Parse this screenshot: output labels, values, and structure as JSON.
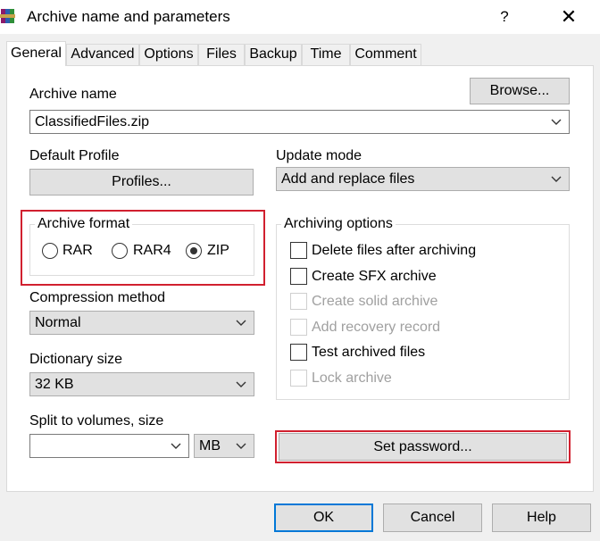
{
  "window": {
    "title": "Archive name and parameters",
    "help_glyph": "?",
    "close_glyph": "✕"
  },
  "tabs": [
    {
      "label": "General",
      "active": true
    },
    {
      "label": "Advanced"
    },
    {
      "label": "Options"
    },
    {
      "label": "Files"
    },
    {
      "label": "Backup"
    },
    {
      "label": "Time"
    },
    {
      "label": "Comment"
    }
  ],
  "archive_name": {
    "label": "Archive name",
    "value": "ClassifiedFiles.zip",
    "browse_label": "Browse..."
  },
  "profile": {
    "label": "Default Profile",
    "button": "Profiles..."
  },
  "update_mode": {
    "label": "Update mode",
    "value": "Add and replace files"
  },
  "archive_format": {
    "title": "Archive format",
    "options": [
      {
        "label": "RAR",
        "selected": false
      },
      {
        "label": "RAR4",
        "selected": false
      },
      {
        "label": "ZIP",
        "selected": true
      }
    ]
  },
  "compression": {
    "label": "Compression method",
    "value": "Normal"
  },
  "dictionary": {
    "label": "Dictionary size",
    "value": "32 KB"
  },
  "split": {
    "label": "Split to volumes, size",
    "value": "",
    "unit": "MB"
  },
  "archiving_options": {
    "title": "Archiving options",
    "items": [
      {
        "label": "Delete files after archiving",
        "checked": false,
        "enabled": true
      },
      {
        "label": "Create SFX archive",
        "checked": false,
        "enabled": true
      },
      {
        "label": "Create solid archive",
        "checked": false,
        "enabled": false
      },
      {
        "label": "Add recovery record",
        "checked": false,
        "enabled": false
      },
      {
        "label": "Test archived files",
        "checked": false,
        "enabled": true
      },
      {
        "label": "Lock archive",
        "checked": false,
        "enabled": false
      }
    ]
  },
  "set_password": "Set password...",
  "footer": {
    "ok": "OK",
    "cancel": "Cancel",
    "help": "Help"
  },
  "colors": {
    "highlight_red": "#d1202f",
    "default_button_blue": "#0078d7"
  },
  "icons": {
    "app": "winrar-books-icon",
    "chevron": "chevron-down-icon"
  }
}
